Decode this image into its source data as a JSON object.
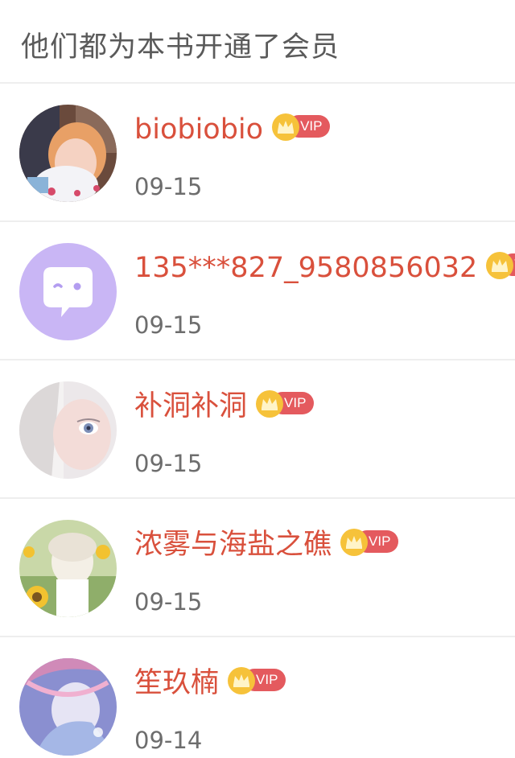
{
  "header": {
    "title": "他们都为本书开通了会员"
  },
  "badge": {
    "vip_label": "VIP"
  },
  "members": [
    {
      "name": "biobiobio",
      "date": "09-15",
      "avatar": "photo-avatar"
    },
    {
      "name": "135***827_9580856032",
      "date": "09-15",
      "avatar": "default-chat-avatar"
    },
    {
      "name": "补洞补洞",
      "date": "09-15",
      "avatar": "photo-avatar"
    },
    {
      "name": "浓雾与海盐之礁",
      "date": "09-15",
      "avatar": "photo-avatar"
    },
    {
      "name": "笙玖楠",
      "date": "09-14",
      "avatar": "photo-avatar"
    }
  ],
  "colors": {
    "name_red": "#d9503c",
    "vip_red": "#e45a5e",
    "crown_gold": "#f6c23a",
    "default_avatar_bg": "#c9b6f5"
  }
}
